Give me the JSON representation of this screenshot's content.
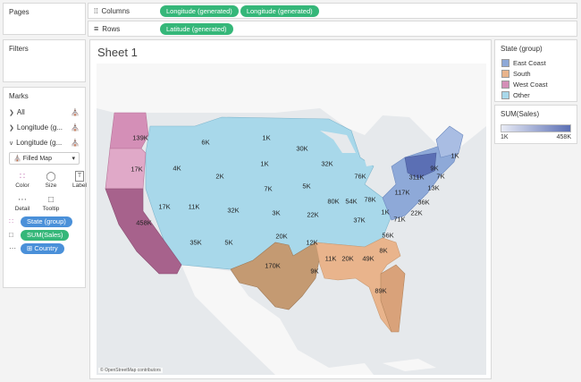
{
  "pages": {
    "title": "Pages"
  },
  "filters": {
    "title": "Filters"
  },
  "shelves": {
    "columns": {
      "label": "Columns",
      "pills": [
        "Longitude (generated)",
        "Longitude (generated)"
      ]
    },
    "rows": {
      "label": "Rows",
      "pills": [
        "Latitude (generated)"
      ]
    }
  },
  "marks": {
    "title": "Marks",
    "rows": [
      {
        "label": "All",
        "icon": "map-icon"
      },
      {
        "label": "Longitude (g...",
        "icon": "map-icon"
      },
      {
        "label": "Longitude (g...",
        "icon": "map-icon"
      }
    ],
    "mark_type": "Filled Map",
    "buttons": [
      {
        "label": "Color",
        "icon": "color-icon"
      },
      {
        "label": "Size",
        "icon": "size-icon"
      },
      {
        "label": "Label",
        "icon": "label-icon"
      },
      {
        "label": "Detail",
        "icon": "detail-icon"
      },
      {
        "label": "Tooltip",
        "icon": "tooltip-icon"
      }
    ],
    "fields": [
      {
        "label": "State (group)",
        "color": "#4a90d9"
      },
      {
        "label": "SUM(Sales)",
        "color": "#35b779"
      },
      {
        "label": "⊞ Country",
        "color": "#4a90d9"
      }
    ]
  },
  "sheet": {
    "title": "Sheet 1"
  },
  "map": {
    "attribution": "© OpenStreetMap contributors",
    "labels": [
      "139K",
      "17K",
      "4K",
      "6K",
      "1K",
      "1K",
      "30K",
      "32K",
      "2K",
      "7K",
      "5K",
      "76K",
      "1K",
      "9K",
      "311K",
      "7K",
      "13K",
      "117K",
      "36K",
      "22K",
      "1K",
      "71K",
      "78K",
      "54K",
      "80K",
      "22K",
      "37K",
      "56K",
      "17K",
      "11K",
      "32K",
      "3K",
      "458K",
      "35K",
      "5K",
      "20K",
      "12K",
      "170K",
      "9K",
      "11K",
      "20K",
      "49K",
      "8K",
      "89K"
    ]
  },
  "legend_state": {
    "title": "State (group)",
    "items": [
      {
        "label": "East Coast",
        "color": "#8ea9d8"
      },
      {
        "label": "South",
        "color": "#e9b48c"
      },
      {
        "label": "West Coast",
        "color": "#d48fb7"
      },
      {
        "label": "Other",
        "color": "#a8d8ea"
      }
    ]
  },
  "legend_sales": {
    "title": "SUM(Sales)",
    "min": "1K",
    "max": "458K",
    "color_low": "#e8ebf5",
    "color_high": "#5b6fb4"
  }
}
